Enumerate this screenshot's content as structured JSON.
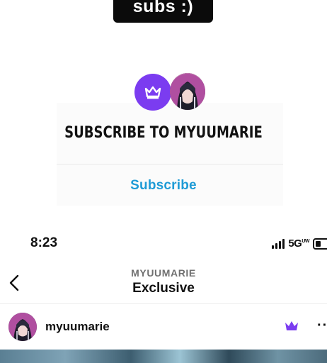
{
  "caption": {
    "text": "subs :)"
  },
  "promo": {
    "title": "SUBSCRIBE TO MYUUMARIE",
    "subscribe_label": "Subscribe",
    "accent_color": "#7b3cf0",
    "link_color": "#1e9bd6"
  },
  "status_bar": {
    "time": "8:23",
    "network": "5G",
    "network_sup": "UW",
    "icons": [
      "signal-icon",
      "battery-icon"
    ]
  },
  "header": {
    "account": "MYUUMARIE",
    "title": "Exclusive",
    "back_icon": "chevron-left-icon"
  },
  "post": {
    "username": "myuumarie",
    "badge_icon": "crown-icon",
    "more_icon": "more-dots-icon"
  }
}
